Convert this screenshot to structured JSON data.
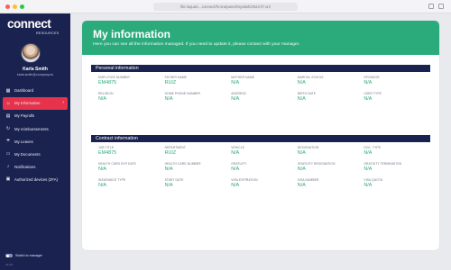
{
  "browser": {
    "url": "file:/aqua/c...connect/hr.sra/panel/mydash/2022-fr/ un/"
  },
  "sidebar": {
    "logo_text": "connect",
    "logo_sub": "RESOURCES",
    "user": {
      "name": "Karla Smith",
      "email": "karla.smith@company.es"
    },
    "items": [
      {
        "label": "Dashboard",
        "icon": "grid-icon",
        "active": false
      },
      {
        "label": "My Information",
        "icon": "user-icon",
        "active": true
      },
      {
        "label": "My Payrolls",
        "icon": "payroll-icon",
        "active": false
      },
      {
        "label": "My reimbursements",
        "icon": "reimbursement-icon",
        "active": false
      },
      {
        "label": "My Leaves",
        "icon": "leave-icon",
        "active": false
      },
      {
        "label": "My Documents",
        "icon": "document-icon",
        "active": false
      },
      {
        "label": "Notifications",
        "icon": "bell-icon",
        "active": false
      },
      {
        "label": "Authorized devices (2FA)",
        "icon": "device-icon",
        "active": false
      }
    ],
    "switch_label": "Switch to manager",
    "version": "v1.0.0"
  },
  "header": {
    "title": "My information",
    "subtitle": "Here you can see all the information managed. If you need to update it, please contact with your manager.",
    "accent_color": "#2bab7b"
  },
  "personal": {
    "title": "Personal information",
    "fields": [
      {
        "label": "EMPLOYEE NUMBER",
        "value": "EM4875"
      },
      {
        "label": "FATHER NAME",
        "value": "RUIZ"
      },
      {
        "label": "MOTHER NAME",
        "value": "N/A"
      },
      {
        "label": "MARITAL STATUS",
        "value": "N/A"
      },
      {
        "label": "SPONSOR",
        "value": "N/A"
      },
      {
        "label": "RELIGION",
        "value": "N/A"
      },
      {
        "label": "HOME PHONE NUMBER",
        "value": "N/A"
      },
      {
        "label": "ADDRESS",
        "value": "N/A"
      },
      {
        "label": "BIRTH DATE",
        "value": "N/A"
      },
      {
        "label": "USER TYPE",
        "value": "N/A"
      }
    ]
  },
  "contract": {
    "title": "Contract information",
    "fields": [
      {
        "label": "JOB TITLE",
        "value": "EM4875"
      },
      {
        "label": "DEPARTMENT",
        "value": "RUIZ"
      },
      {
        "label": "VEHICLE",
        "value": "N/A"
      },
      {
        "label": "DESIGNATION",
        "value": "N/A"
      },
      {
        "label": "DOC. TYPE",
        "value": "N/A"
      },
      {
        "label": "HEALTH CARD EXP DATE",
        "value": "N/A"
      },
      {
        "label": "HEALTH CARD NUMBER",
        "value": "N/A"
      },
      {
        "label": "GRATUITY",
        "value": "N/A"
      },
      {
        "label": "GRATUITY RESIGNATION",
        "value": "N/A"
      },
      {
        "label": "GRATUITY TERMINATION",
        "value": "N/A"
      },
      {
        "label": "INSURANCE TYPE",
        "value": "N/A"
      },
      {
        "label": "START DATE",
        "value": "N/A"
      },
      {
        "label": "VISA EXPIRATION",
        "value": "N/A"
      },
      {
        "label": "VISA NUMBER",
        "value": "N/A"
      },
      {
        "label": "VISA QUOTA",
        "value": "N/A"
      }
    ]
  }
}
